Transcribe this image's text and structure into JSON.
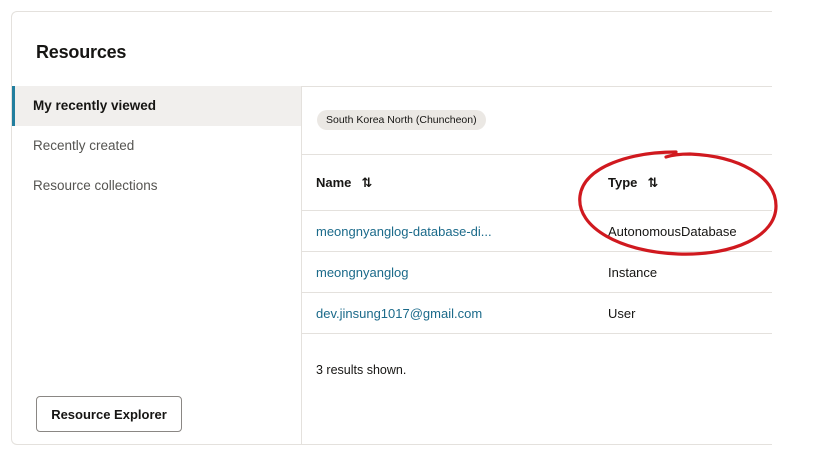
{
  "panel": {
    "title": "Resources"
  },
  "sidebar": {
    "items": [
      {
        "label": "My recently viewed",
        "active": true
      },
      {
        "label": "Recently created",
        "active": false
      },
      {
        "label": "Resource collections",
        "active": false
      }
    ],
    "explorer_button": "Resource Explorer"
  },
  "main": {
    "region_chip": "South Korea North (Chuncheon)",
    "table": {
      "columns": [
        {
          "label": "Name",
          "sort_icon": "sort-icon"
        },
        {
          "label": "Type",
          "sort_icon": "sort-icon"
        }
      ],
      "rows": [
        {
          "name": "meongnyanglog-database-di...",
          "type": "AutonomousDatabase"
        },
        {
          "name": "meongnyanglog",
          "type": "Instance"
        },
        {
          "name": "dev.jinsung1017@gmail.com",
          "type": "User"
        }
      ]
    },
    "results_text": "3 results shown."
  },
  "colors": {
    "link": "#1b6a8a",
    "accent": "#227e9e",
    "annotation": "#d0191f"
  }
}
